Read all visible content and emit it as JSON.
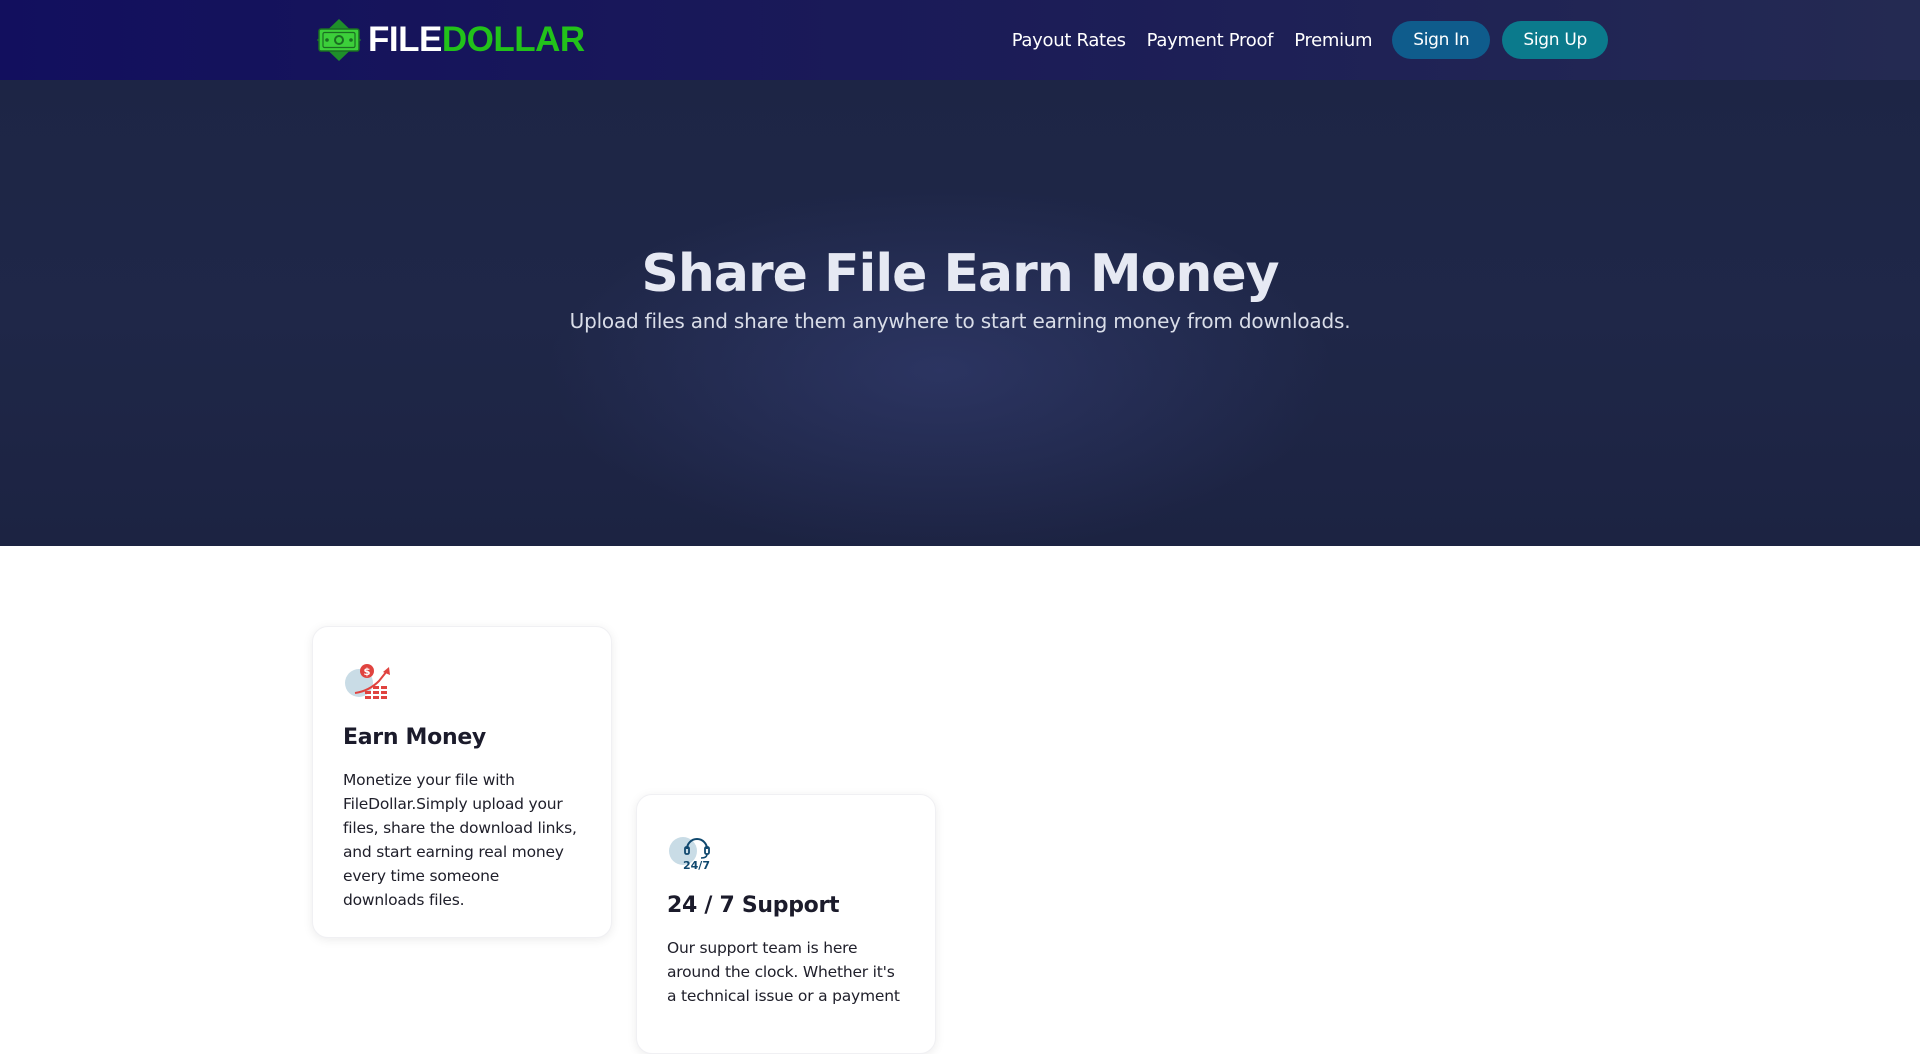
{
  "header": {
    "logo": {
      "part1": "FILE",
      "part2": "DOLLAR",
      "icon": "money-bill-icon"
    },
    "nav": [
      {
        "label": "Payout Rates"
      },
      {
        "label": "Payment Proof"
      },
      {
        "label": "Premium"
      }
    ],
    "sign_in_label": "Sign In",
    "sign_up_label": "Sign Up"
  },
  "hero": {
    "title": "Share File Earn Money",
    "subtitle": "Upload files and share them anywhere to start earning money from downloads."
  },
  "features": [
    {
      "icon": "earn-money-chart-icon",
      "title": "Earn Money",
      "text": "Monetize your file with FileDollar.Simply upload your files, share the download links, and start earning real money every time someone downloads files."
    },
    {
      "icon": "support-24-7-icon",
      "title": "24 / 7 Support",
      "text": "Our support team is here around the clock. Whether it's a technical issue or a payment"
    }
  ],
  "colors": {
    "nav_bg": "#120f5e",
    "hero_bg": "#1d2545",
    "brand_green": "#22c21a",
    "sign_in_bg": "#0f5c8c",
    "sign_up_bg": "#0b7a8c"
  }
}
